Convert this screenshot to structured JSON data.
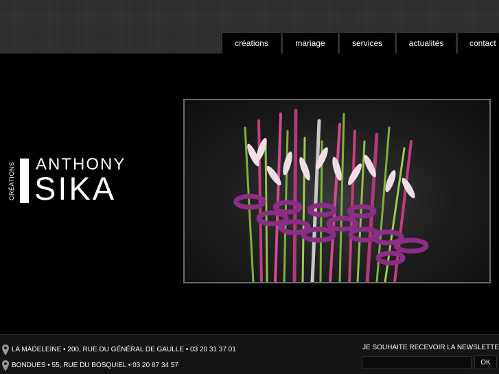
{
  "nav": {
    "items": [
      {
        "label": "créations"
      },
      {
        "label": "mariage"
      },
      {
        "label": "services"
      },
      {
        "label": "actualités"
      },
      {
        "label": "contact"
      }
    ]
  },
  "logo": {
    "creations": "CRÉATIONS",
    "name_first": "ANTHONY",
    "name_last": "SIKA"
  },
  "hero": {
    "image_description": "floral arrangement of purple rings with pink and green stems"
  },
  "footer": {
    "addresses": [
      {
        "icon": "location-pin-icon",
        "text": "LA MADELEINE • 200, RUE DU GÉNÉRAL DE GAULLE • 03 20 31 37 01"
      },
      {
        "icon": "location-pin-icon",
        "text": "BONDUES • 55, RUE DU BOSQUIEL • 03 20 87 34 57"
      }
    ],
    "newsletter": {
      "label": "JE SOUHAITE RECEVOIR LA NEWSLETTER",
      "input_value": "",
      "button_label": "OK"
    }
  },
  "colors": {
    "background": "#000000",
    "topbar": "#2a2a2a",
    "ring": "#8c2d86",
    "stem_green": "#7fb23a",
    "stem_pink": "#c23f7a"
  }
}
